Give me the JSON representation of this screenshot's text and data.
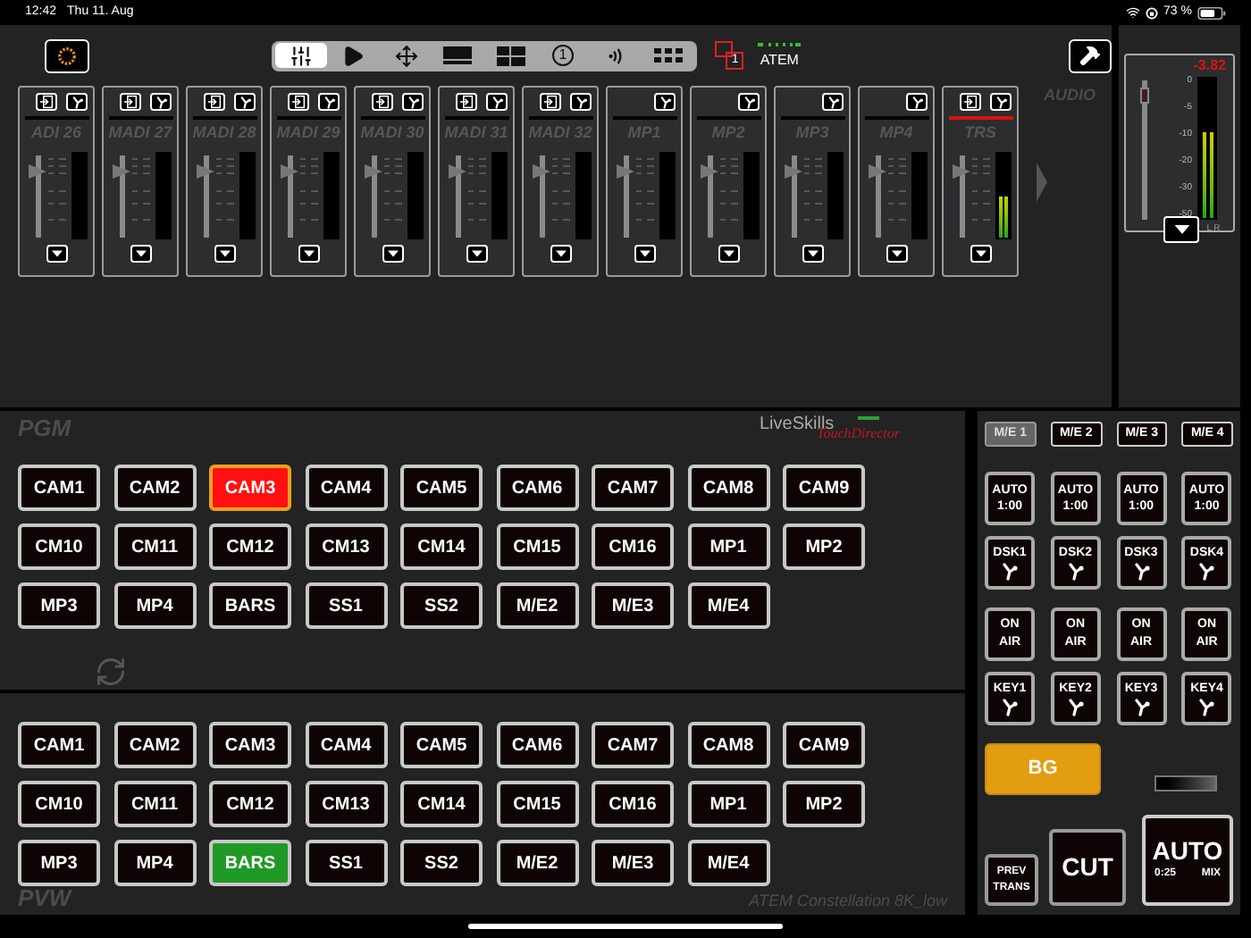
{
  "status_bar": {
    "time": "12:42",
    "date": "Thu 11. Aug",
    "battery": "73 %"
  },
  "toolbar": {
    "tabs": [
      {
        "kind": "mixer",
        "selected": true
      },
      {
        "kind": "play",
        "selected": false
      },
      {
        "kind": "move",
        "selected": false
      },
      {
        "kind": "screen",
        "selected": false
      },
      {
        "kind": "layout",
        "selected": false
      },
      {
        "kind": "number",
        "label": "1",
        "selected": false
      },
      {
        "kind": "audio",
        "selected": false
      },
      {
        "kind": "dots",
        "selected": false
      }
    ],
    "switcher_badge": "1",
    "switcher": "ATEM"
  },
  "audio": {
    "label": "AUDIO",
    "strips": [
      {
        "name": "ADI 26",
        "input_button": true,
        "active": false,
        "fader": {
          "level": 0.8
        }
      },
      {
        "name": "MADI 27",
        "input_button": true,
        "active": false,
        "fader": {
          "level": 0.8
        }
      },
      {
        "name": "MADI 28",
        "input_button": true,
        "active": false,
        "fader": {
          "level": 0.8
        }
      },
      {
        "name": "MADI 29",
        "input_button": true,
        "active": false,
        "fader": {
          "level": 0.8
        }
      },
      {
        "name": "MADI 30",
        "input_button": true,
        "active": false,
        "fader": {
          "level": 0.8
        }
      },
      {
        "name": "MADI 31",
        "input_button": true,
        "active": false,
        "fader": {
          "level": 0.8
        }
      },
      {
        "name": "MADI 32",
        "input_button": true,
        "active": false,
        "fader": {
          "level": 0.8
        }
      },
      {
        "name": "MP1",
        "input_button": false,
        "active": false,
        "fader": {
          "level": 0.8
        }
      },
      {
        "name": "MP2",
        "input_button": false,
        "active": false,
        "fader": {
          "level": 0.8
        }
      },
      {
        "name": "MP3",
        "input_button": false,
        "active": false,
        "fader": {
          "level": 0.8
        }
      },
      {
        "name": "MP4",
        "input_button": false,
        "active": false,
        "fader": {
          "level": 0.8
        }
      },
      {
        "name": "TRS",
        "input_button": true,
        "active": true,
        "fader": {
          "level": 0.8
        },
        "meter": {
          "level": 0.5
        }
      }
    ]
  },
  "master": {
    "reading": "-3.82",
    "scale": [
      "0",
      "-5",
      "-10",
      "-20",
      "-30",
      "-50"
    ],
    "fader": {
      "level": 0.9
    },
    "meter": {
      "level": 0.62
    },
    "channels": "L R"
  },
  "pgm": {
    "label": "PGM",
    "sources": [
      {
        "label": "CAM1",
        "selected": false
      },
      {
        "label": "CAM2",
        "selected": false
      },
      {
        "label": "CAM3",
        "selected": true
      },
      {
        "label": "CAM4",
        "selected": false
      },
      {
        "label": "CAM5",
        "selected": false
      },
      {
        "label": "CAM6",
        "selected": false
      },
      {
        "label": "CAM7",
        "selected": false
      },
      {
        "label": "CAM8",
        "selected": false
      },
      {
        "label": "CAM9",
        "selected": false
      },
      {
        "label": "CM10",
        "selected": false
      },
      {
        "label": "CM11",
        "selected": false
      },
      {
        "label": "CM12",
        "selected": false
      },
      {
        "label": "CM13",
        "selected": false
      },
      {
        "label": "CM14",
        "selected": false
      },
      {
        "label": "CM15",
        "selected": false
      },
      {
        "label": "CM16",
        "selected": false
      },
      {
        "label": "MP1",
        "selected": false
      },
      {
        "label": "MP2",
        "selected": false
      },
      {
        "label": "MP3",
        "selected": false
      },
      {
        "label": "MP4",
        "selected": false
      },
      {
        "label": "BARS",
        "selected": false
      },
      {
        "label": "SS1",
        "selected": false
      },
      {
        "label": "SS2",
        "selected": false
      },
      {
        "label": "M/E2",
        "selected": false
      },
      {
        "label": "M/E3",
        "selected": false
      },
      {
        "label": "M/E4",
        "selected": false
      }
    ]
  },
  "brand": {
    "name": "LiveSkills",
    "product": "TouchDirector"
  },
  "pvw": {
    "label": "PVW",
    "sources": [
      {
        "label": "CAM1",
        "selected": false
      },
      {
        "label": "CAM2",
        "selected": false
      },
      {
        "label": "CAM3",
        "selected": false
      },
      {
        "label": "CAM4",
        "selected": false
      },
      {
        "label": "CAM5",
        "selected": false
      },
      {
        "label": "CAM6",
        "selected": false
      },
      {
        "label": "CAM7",
        "selected": false
      },
      {
        "label": "CAM8",
        "selected": false
      },
      {
        "label": "CAM9",
        "selected": false
      },
      {
        "label": "CM10",
        "selected": false
      },
      {
        "label": "CM11",
        "selected": false
      },
      {
        "label": "CM12",
        "selected": false
      },
      {
        "label": "CM13",
        "selected": false
      },
      {
        "label": "CM14",
        "selected": false
      },
      {
        "label": "CM15",
        "selected": false
      },
      {
        "label": "CM16",
        "selected": false
      },
      {
        "label": "MP1",
        "selected": false
      },
      {
        "label": "MP2",
        "selected": false
      },
      {
        "label": "MP3",
        "selected": false
      },
      {
        "label": "MP4",
        "selected": false
      },
      {
        "label": "BARS",
        "selected": true
      },
      {
        "label": "SS1",
        "selected": false
      },
      {
        "label": "SS2",
        "selected": false
      },
      {
        "label": "M/E2",
        "selected": false
      },
      {
        "label": "M/E3",
        "selected": false
      },
      {
        "label": "M/E4",
        "selected": false
      }
    ]
  },
  "device": "ATEM Constellation 8K_low",
  "me_tabs": [
    {
      "label": "M/E 1",
      "selected": true
    },
    {
      "label": "M/E 2",
      "selected": false
    },
    {
      "label": "M/E 3",
      "selected": false
    },
    {
      "label": "M/E 4",
      "selected": false
    }
  ],
  "auto_buttons": [
    {
      "label": "AUTO",
      "rate": "1:00"
    },
    {
      "label": "AUTO",
      "rate": "1:00"
    },
    {
      "label": "AUTO",
      "rate": "1:00"
    },
    {
      "label": "AUTO",
      "rate": "1:00"
    }
  ],
  "dsk": [
    {
      "label": "DSK1"
    },
    {
      "label": "DSK2"
    },
    {
      "label": "DSK3"
    },
    {
      "label": "DSK4"
    }
  ],
  "on_air": [
    {
      "label": "ON AIR",
      "on": false
    },
    {
      "label": "ON AIR",
      "on": false
    },
    {
      "label": "ON AIR",
      "on": false
    },
    {
      "label": "ON AIR",
      "on": false
    }
  ],
  "keys": [
    {
      "label": "KEY1"
    },
    {
      "label": "KEY2"
    },
    {
      "label": "KEY3"
    },
    {
      "label": "KEY4"
    }
  ],
  "bg": {
    "label": "BG",
    "selected": true
  },
  "prev_trans": "PREV TRANS",
  "cut": "CUT",
  "auto": {
    "label": "AUTO",
    "rate": "0:25",
    "transition": "MIX"
  }
}
